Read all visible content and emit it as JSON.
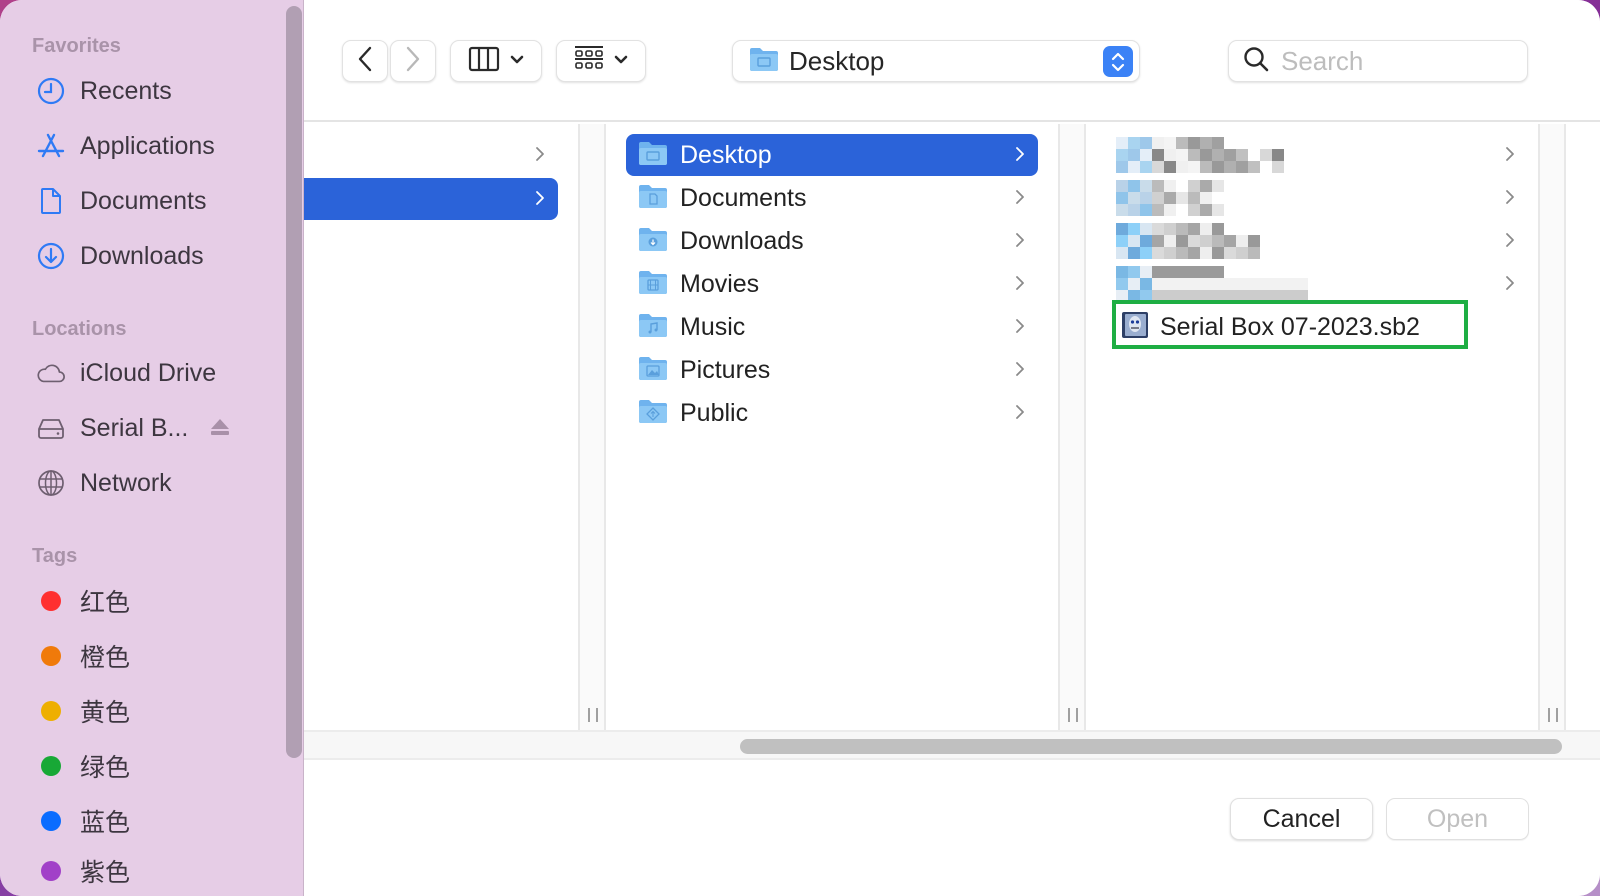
{
  "sidebar": {
    "favorites_title": "Favorites",
    "favorites": [
      {
        "label": "Recents",
        "icon": "clock-icon"
      },
      {
        "label": "Applications",
        "icon": "applications-icon"
      },
      {
        "label": "Documents",
        "icon": "document-icon"
      },
      {
        "label": "Downloads",
        "icon": "download-icon"
      }
    ],
    "locations_title": "Locations",
    "locations": [
      {
        "label": "iCloud Drive",
        "icon": "cloud-icon"
      },
      {
        "label": "Serial B...",
        "icon": "drive-icon",
        "ejectable": true
      },
      {
        "label": "Network",
        "icon": "globe-icon"
      }
    ],
    "tags_title": "Tags",
    "tags": [
      {
        "label": "红色",
        "color": "#ff3030"
      },
      {
        "label": "橙色",
        "color": "#f07a0a"
      },
      {
        "label": "黄色",
        "color": "#eeaf00"
      },
      {
        "label": "绿色",
        "color": "#18a836"
      },
      {
        "label": "蓝色",
        "color": "#0a6cff"
      },
      {
        "label": "紫色",
        "color": "#a140c8"
      }
    ]
  },
  "toolbar": {
    "back_icon": "chevron-left-icon",
    "forward_icon": "chevron-right-icon",
    "view_mode_icon": "columns-view-icon",
    "group_icon": "grid-group-icon",
    "path_popup_label": "Desktop",
    "search_placeholder": "Search",
    "search_value": ""
  },
  "columns": {
    "col1": {
      "rows": [
        {
          "label": "",
          "has_children": true,
          "selected": false
        },
        {
          "label": "",
          "has_children": true,
          "selected": true
        }
      ]
    },
    "col2": {
      "rows": [
        {
          "label": "Desktop",
          "icon": "desktop-folder-icon",
          "has_children": true,
          "selected": true
        },
        {
          "label": "Documents",
          "icon": "documents-folder-icon",
          "has_children": true,
          "selected": false
        },
        {
          "label": "Downloads",
          "icon": "downloads-folder-icon",
          "has_children": true,
          "selected": false
        },
        {
          "label": "Movies",
          "icon": "movies-folder-icon",
          "has_children": true,
          "selected": false
        },
        {
          "label": "Music",
          "icon": "music-folder-icon",
          "has_children": true,
          "selected": false
        },
        {
          "label": "Pictures",
          "icon": "pictures-folder-icon",
          "has_children": true,
          "selected": false
        },
        {
          "label": "Public",
          "icon": "public-folder-icon",
          "has_children": true,
          "selected": false
        }
      ]
    },
    "col3": {
      "rows": [
        {
          "label": "[pixelated folder]",
          "blurred": true,
          "has_children": true
        },
        {
          "label": "[pixelated folder]",
          "blurred": true,
          "has_children": true
        },
        {
          "label": "[pixelated folder]",
          "blurred": true,
          "has_children": true
        },
        {
          "label": "[pixelated folder]",
          "blurred": true,
          "has_children": true
        },
        {
          "label": "Serial Box 07-2023.sb2",
          "icon": "serial-box-file-icon",
          "has_children": false,
          "highlighted": true
        }
      ]
    }
  },
  "footer": {
    "cancel_label": "Cancel",
    "open_label": "Open",
    "open_enabled": false
  },
  "colors": {
    "accent": "#2b63d9",
    "sidebar_bg": "#e6cde6",
    "highlight_annotation": "#1eae43"
  }
}
